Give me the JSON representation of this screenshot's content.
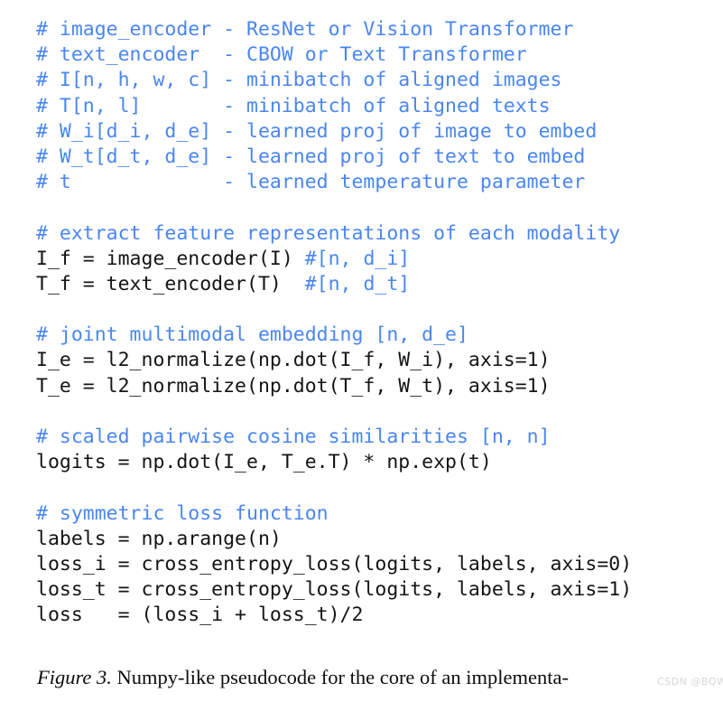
{
  "figure": {
    "caption_label": "Figure 3.",
    "caption_text": " Numpy-like pseudocode for the core of an implementa-",
    "watermark": "CSDN @BQW_"
  },
  "colors": {
    "comment": "#4a86f0",
    "code": "#141414",
    "background": "#ffffff",
    "caption": "#0d0d0d",
    "watermark": "#d7d7d7"
  },
  "code": {
    "language": "python-pseudocode",
    "lines": [
      {
        "comment": "# image_encoder - ResNet or Vision Transformer",
        "code": ""
      },
      {
        "comment": "# text_encoder  - CBOW or Text Transformer",
        "code": ""
      },
      {
        "comment": "# I[n, h, w, c] - minibatch of aligned images",
        "code": ""
      },
      {
        "comment": "# T[n, l]       - minibatch of aligned texts",
        "code": ""
      },
      {
        "comment": "# W_i[d_i, d_e] - learned proj of image to embed",
        "code": ""
      },
      {
        "comment": "# W_t[d_t, d_e] - learned proj of text to embed",
        "code": ""
      },
      {
        "comment": "# t             - learned temperature parameter",
        "code": ""
      },
      {
        "comment": "",
        "code": ""
      },
      {
        "comment": "# extract feature representations of each modality",
        "code": ""
      },
      {
        "code": "I_f = image_encoder(I) ",
        "comment": "#[n, d_i]"
      },
      {
        "code": "T_f = text_encoder(T)  ",
        "comment": "#[n, d_t]"
      },
      {
        "comment": "",
        "code": ""
      },
      {
        "comment": "# joint multimodal embedding [n, d_e]",
        "code": ""
      },
      {
        "code": "I_e = l2_normalize(np.dot(I_f, W_i), axis=1)",
        "comment": ""
      },
      {
        "code": "T_e = l2_normalize(np.dot(T_f, W_t), axis=1)",
        "comment": ""
      },
      {
        "comment": "",
        "code": ""
      },
      {
        "comment": "# scaled pairwise cosine similarities [n, n]",
        "code": ""
      },
      {
        "code": "logits = np.dot(I_e, T_e.T) * np.exp(t)",
        "comment": ""
      },
      {
        "comment": "",
        "code": ""
      },
      {
        "comment": "# symmetric loss function",
        "code": ""
      },
      {
        "code": "labels = np.arange(n)",
        "comment": ""
      },
      {
        "code": "loss_i = cross_entropy_loss(logits, labels, axis=0)",
        "comment": ""
      },
      {
        "code": "loss_t = cross_entropy_loss(logits, labels, axis=1)",
        "comment": ""
      },
      {
        "code": "loss   = (loss_i + loss_t)/2",
        "comment": ""
      }
    ]
  }
}
